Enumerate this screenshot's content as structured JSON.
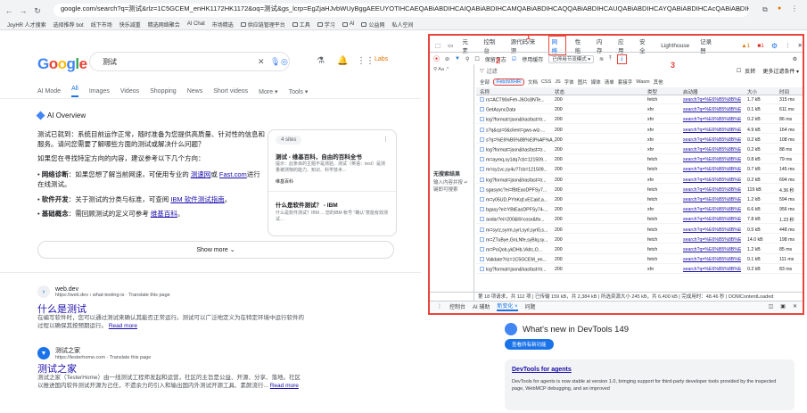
{
  "browser": {
    "url": "google.com/search?q=测试&rlz=1C5GCEM_enHK1172HK1172&oq=测试&gs_lcrp=EgZjaHJvbWUyBggAEEUYOTIHCAEQABiABDIHCAIQABiABDIHCAMQABiABDIHCAQQABiABDIHCAUQABiABDIHCAYQABiABDIHCAcQABiABDIHCAgQABiABDI...",
    "bookmarks": [
      "JoyHR 人才搜索",
      "选择推荐 bot",
      "线下市场",
      "快乐减重",
      "精选网络聚合",
      "AI Chat",
      "市场精选",
      "供应链管理平台",
      "工具",
      "学习",
      "AI",
      "公益网",
      "私人空间"
    ]
  },
  "google": {
    "logo": "Google",
    "query": "测试",
    "labs": "Labs",
    "tabs": [
      "AI Mode",
      "All",
      "Images",
      "Videos",
      "Shopping",
      "News",
      "Short videos",
      "More ▾",
      "Tools ▾"
    ],
    "ai_overview": "AI Overview",
    "p1": "测试已就到：系统目前运作正常，随时准备为您提供高质量、针对性的信息和服务。请问您需要了解哪些方面的测试或解决什么问题？",
    "p2": "如果您在寻找特定方向的内容，建议参考以下几个方向：",
    "b1_label": "网络诊断",
    "b1_text": "：如果您想了解当前网速，可使用专业的",
    "b1_link1": "测速网",
    "b1_mid": "或",
    "b1_link2": "Fast.com",
    "b1_end": "进行在线测试。",
    "b2_label": "软件开发",
    "b2_text": "：关于测试的分类与标准，可查阅",
    "b2_link": "IBM 软件测试指南",
    "b2_end": "。",
    "b3_label": "基础概念",
    "b3_text": "：需回顾测试的定义可参考",
    "b3_link": "维基百科",
    "b3_end": "。",
    "card": {
      "sites": "4 sites",
      "t1": "测试 - 维基百科，自由的百科全书",
      "s1": "提示：此条目的主题不是测验、测试（英语：test）是测量被测物的能力、知识、科学技术...",
      "src1": "维基百科",
      "t2": "什么是软件测试？ - IBM",
      "s2": "什么是软件测试？IBM ... 您的IBM 帐号 \"确认\"意能有效测试..."
    },
    "show_more": "Show more",
    "r1": {
      "site": "web.dev",
      "url": "https://web.dev › what-testing-is · Translate this page",
      "title": "什么是测试",
      "snippet": "在编写软件时，您可以通过测试来确认其能否正常运行。测试可以广泛地定义为在特定环境中运行软件的过程以确保其按预期运行。",
      "readmore": "Read more"
    },
    "r2": {
      "site": "测试之家",
      "url": "https://testerhome.com · Translate this page",
      "title": "测试之家",
      "snippet": "测试之家（TesterHome）由一线测试工程师发起和运营，社区的主旨是公益、开源、分享、落地。社区以推进国内软件测试开源为己任，不遗余力的引入和输出国内外测试开源工具、素颜流行...",
      "readmore": "Read more"
    }
  },
  "devtools": {
    "tabs": [
      "元素",
      "控制台",
      "源代码/来源",
      "网络",
      "性能",
      "内存",
      "应用",
      "安全",
      "Lighthouse",
      "记录器"
    ],
    "badge_err": "▲1",
    "badge_warn": "■1",
    "labels": [
      "1",
      "2",
      "3"
    ],
    "controls": {
      "preserve_log": "保留日志",
      "disable_cache": "停用缓存",
      "throttle": "已停用节流模式 ▾",
      "invert": "反转",
      "more_filters": "更多过滤条件 ▾"
    },
    "filter_placeholder": "过滤",
    "type_filters": [
      "全部",
      "Fetch/XHR",
      "文档",
      "CSS",
      "JS",
      "字体",
      "图片",
      "媒体",
      "清单",
      "套接字",
      "Wasm",
      "其他"
    ],
    "left_pane": {
      "title": "无搜索结果",
      "hint": "输入内容并按 ↵ 键即可搜索"
    },
    "columns": [
      "名称",
      "状态",
      "类型",
      "启动器",
      "大小",
      "时间"
    ],
    "rows": [
      {
        "name": "rs=ACT90oFeh-J6Oc8NTe...",
        "status": "200",
        "type": "fetch",
        "initiator": "search?q=%E6%B5%8B%E",
        "size": "1.7 kB",
        "time": "315 ms"
      },
      {
        "name": "GetAsyncData",
        "status": "200",
        "type": "xhr",
        "initiator": "search?q=%E6%B5%8B%E",
        "size": "0.1 kB",
        "time": "611 ms"
      },
      {
        "name": "log?format=json&hasfast=tr...",
        "status": "200",
        "type": "xhr",
        "initiator": "search?q=%E6%B5%8B%E",
        "size": "0.2 kB",
        "time": "86 ms"
      },
      {
        "name": "s?q&cp=0&client=gws-wiz-...",
        "status": "200",
        "type": "xhr",
        "initiator": "search?q=%E6%B5%8B%E",
        "size": "4.9 kB",
        "time": "164 ms"
      },
      {
        "name": "s?q=%E6%B5%8B%E8%AF%A...",
        "status": "200",
        "type": "xhr",
        "initiator": "search?q=%E6%B5%8B%E",
        "size": "0.2 kB",
        "time": "108 ms"
      },
      {
        "name": "log?format=json&hasfast=tr...",
        "status": "200",
        "type": "xhr",
        "initiator": "search?q=%E6%B5%8B%E",
        "size": "0.2 kB",
        "time": "88 ms"
      },
      {
        "name": "m=aymq,sy1dq7cb=121509...",
        "status": "200",
        "type": "fetch",
        "initiator": "search?q=%E6%B5%8B%E",
        "size": "0.8 kB",
        "time": "79 ms"
      },
      {
        "name": "m=sy1vc,sy4u?7cb=121509...",
        "status": "200",
        "type": "fetch",
        "initiator": "search?q=%E6%B5%8B%E",
        "size": "0.7 kB",
        "time": "145 ms"
      },
      {
        "name": "log?format=json&hasfast=tr...",
        "status": "200",
        "type": "xhr",
        "initiator": "search?q=%E6%B5%8B%E",
        "size": "0.2 kB",
        "time": "694 ms"
      },
      {
        "name": "sgasync?ei=fBtEaoDPFSy7...",
        "status": "200",
        "type": "fetch",
        "initiator": "search?q=%E6%B5%8B%E",
        "size": "119 kB",
        "time": "4.36 秒"
      },
      {
        "name": "m=y05UD,PYhKqf,vECakf,a...",
        "status": "200",
        "type": "fetch",
        "initiator": "search?q=%E6%B5%8B%E",
        "size": "1.2 kB",
        "time": "594 ms"
      },
      {
        "name": "bgasy?ei=YBtEaoDPFSy74-...",
        "status": "200",
        "type": "xhr",
        "initiator": "search?q=%E6%B5%8B%E",
        "size": "6.6 kB",
        "time": "956 ms"
      },
      {
        "name": "aodar?ei=200&lli=cosx&ttv...",
        "status": "200",
        "type": "fetch",
        "initiator": "search?q=%E6%B5%8B%E",
        "size": "7.8 kB",
        "time": "1.23 秒"
      },
      {
        "name": "m=syrz,syrm,syrl,syrl,syrl0,s...",
        "status": "200",
        "type": "fetch",
        "initiator": "search?q=%E6%B5%8B%E",
        "size": "0.5 kB",
        "time": "448 ms"
      },
      {
        "name": "m=ZTuBye,GnLNfe,syBlq,sy...",
        "status": "200",
        "type": "fetch",
        "initiator": "search?q=%E6%B5%8B%E",
        "size": "14.0 kB",
        "time": "198 ms"
      },
      {
        "name": "m=PoQob,ykDHb,Vkltc,O...",
        "status": "200",
        "type": "fetch",
        "initiator": "search?q=%E6%B5%8B%E",
        "size": "1.2 kB",
        "time": "85 ms"
      },
      {
        "name": "Validate?rlz=1C5GCEM_en...",
        "status": "200",
        "type": "fetch",
        "initiator": "search?q=%E6%B5%8B%E",
        "size": "0.1 kB",
        "time": "111 ms"
      },
      {
        "name": "log?format=json&hasfast=tr...",
        "status": "200",
        "type": "xhr",
        "initiator": "search?q=%E6%B5%8B%E",
        "size": "0.2 kB",
        "time": "83 ms"
      }
    ],
    "status_bar": "第 18 项请求，共 112 项 | 已传输 159 kB，共 2,384 kB | 所选资源大小 245 kB，共 6,400 kB | 完成用时：48.46 秒 | DOMContentLoaded",
    "drawer_tabs": [
      "控制台",
      "AI 辅助",
      "新变化 ×",
      "问题"
    ],
    "whats_new": {
      "title": "What's new in DevTools 149",
      "button": "查看所有新功能",
      "card_title": "DevTools for agents",
      "card_body": "DevTools for agents is now stable at version 1.0, bringing support for third-party developer tools provided by the inspected page, WebMCP debugging, and an improved"
    }
  }
}
